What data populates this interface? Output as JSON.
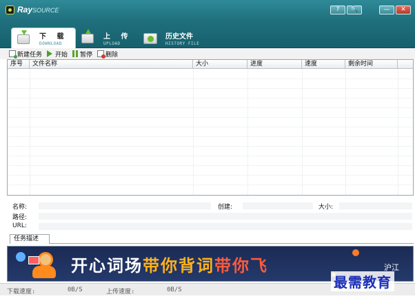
{
  "app": {
    "logo_main": "Ray",
    "logo_sub": "SOURCE"
  },
  "window_buttons": {
    "help": "?",
    "search": "🔍",
    "minimize": "—",
    "close": "✕"
  },
  "tabs": [
    {
      "label": "下 载",
      "sub": "DOWNLOAD",
      "icon": "download-box-icon",
      "active": true
    },
    {
      "label": "上 传",
      "sub": "UPLOAD",
      "icon": "upload-box-icon",
      "active": false
    },
    {
      "label": "历史文件",
      "sub": "HISTORY FILE",
      "icon": "history-box-icon",
      "active": false
    }
  ],
  "toolbar": {
    "new_task": "新建任务",
    "start": "开始",
    "pause": "暂停",
    "delete": "删除"
  },
  "table": {
    "columns": [
      "序号",
      "文件名称",
      "大小",
      "进度",
      "速度",
      "剩余时间"
    ],
    "rows": []
  },
  "details": {
    "name_label": "名称:",
    "path_label": "路径:",
    "url_label": "URL:",
    "created_label": "创建:",
    "size_label": "大小:"
  },
  "desc_tab": "任务描述",
  "banner": {
    "text_white": "开心词场",
    "text_yellow": "带你背词",
    "text_red": "带你飞",
    "brand": "沪江"
  },
  "status": {
    "download_label": "下载速度:",
    "download_value": "0B/S",
    "upload_label": "上传速度:",
    "upload_value": "0B/S"
  },
  "watermark": "最需教育",
  "colors": {
    "titlebar": "#1f6f7d",
    "accent_green": "#6bbb2a",
    "banner_bg": "#1c2a55"
  }
}
